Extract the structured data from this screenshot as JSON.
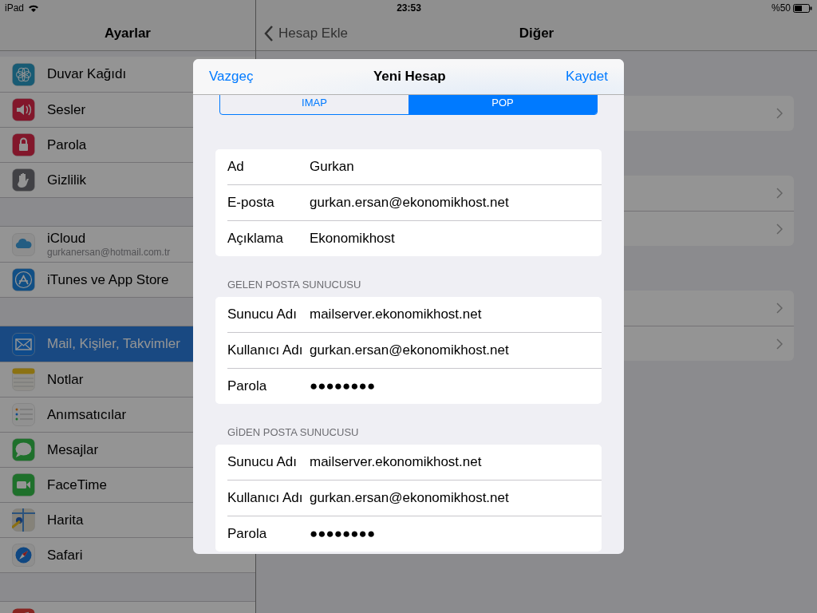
{
  "status_bar": {
    "device": "iPad",
    "time": "23:53",
    "battery": "%50"
  },
  "sidebar": {
    "title": "Ayarlar",
    "groups": [
      [
        {
          "label": "Duvar Kağıdı",
          "selected": false
        },
        {
          "label": "Sesler",
          "selected": false
        },
        {
          "label": "Parola",
          "selected": false
        },
        {
          "label": "Gizlilik",
          "selected": false
        }
      ],
      [
        {
          "label": "iCloud",
          "subtitle": "gurkanersan@hotmail.com.tr",
          "selected": false
        },
        {
          "label": "iTunes ve App Store",
          "selected": false
        }
      ],
      [
        {
          "label": "Mail, Kişiler, Takvimler",
          "selected": true
        },
        {
          "label": "Notlar",
          "selected": false
        },
        {
          "label": "Anımsatıcılar",
          "selected": false
        },
        {
          "label": "Mesajlar",
          "selected": false
        },
        {
          "label": "FaceTime",
          "selected": false
        },
        {
          "label": "Harita",
          "selected": false
        },
        {
          "label": "Safari",
          "selected": false
        }
      ]
    ]
  },
  "detail": {
    "back": "Hesap Ekle",
    "title": "Diğer"
  },
  "modal": {
    "title": "Yeni Hesap",
    "cancel": "Vazgeç",
    "save": "Kaydet",
    "segments": [
      {
        "label": "IMAP",
        "selected": false
      },
      {
        "label": "POP",
        "selected": true
      }
    ],
    "sections": [
      {
        "fields": [
          {
            "label": "Ad",
            "value": "Gurkan"
          },
          {
            "label": "E-posta",
            "value": "gurkan.ersan@ekonomikhost.net"
          },
          {
            "label": "Açıklama",
            "value": "Ekonomikhost"
          }
        ]
      },
      {
        "header": "GELEN POSTA SUNUCUSU",
        "fields": [
          {
            "label": "Sunucu Adı",
            "value": "mailserver.ekonomikhost.net"
          },
          {
            "label": "Kullanıcı Adı",
            "value": "gurkan.ersan@ekonomikhost.net"
          },
          {
            "label": "Parola",
            "value": "●●●●●●●●"
          }
        ]
      },
      {
        "header": "GİDEN POSTA SUNUCUSU",
        "fields": [
          {
            "label": "Sunucu Adı",
            "value": "mailserver.ekonomikhost.net"
          },
          {
            "label": "Kullanıcı Adı",
            "value": "gurkan.ersan@ekonomikhost.net"
          },
          {
            "label": "Parola",
            "value": "●●●●●●●●"
          }
        ]
      }
    ]
  }
}
